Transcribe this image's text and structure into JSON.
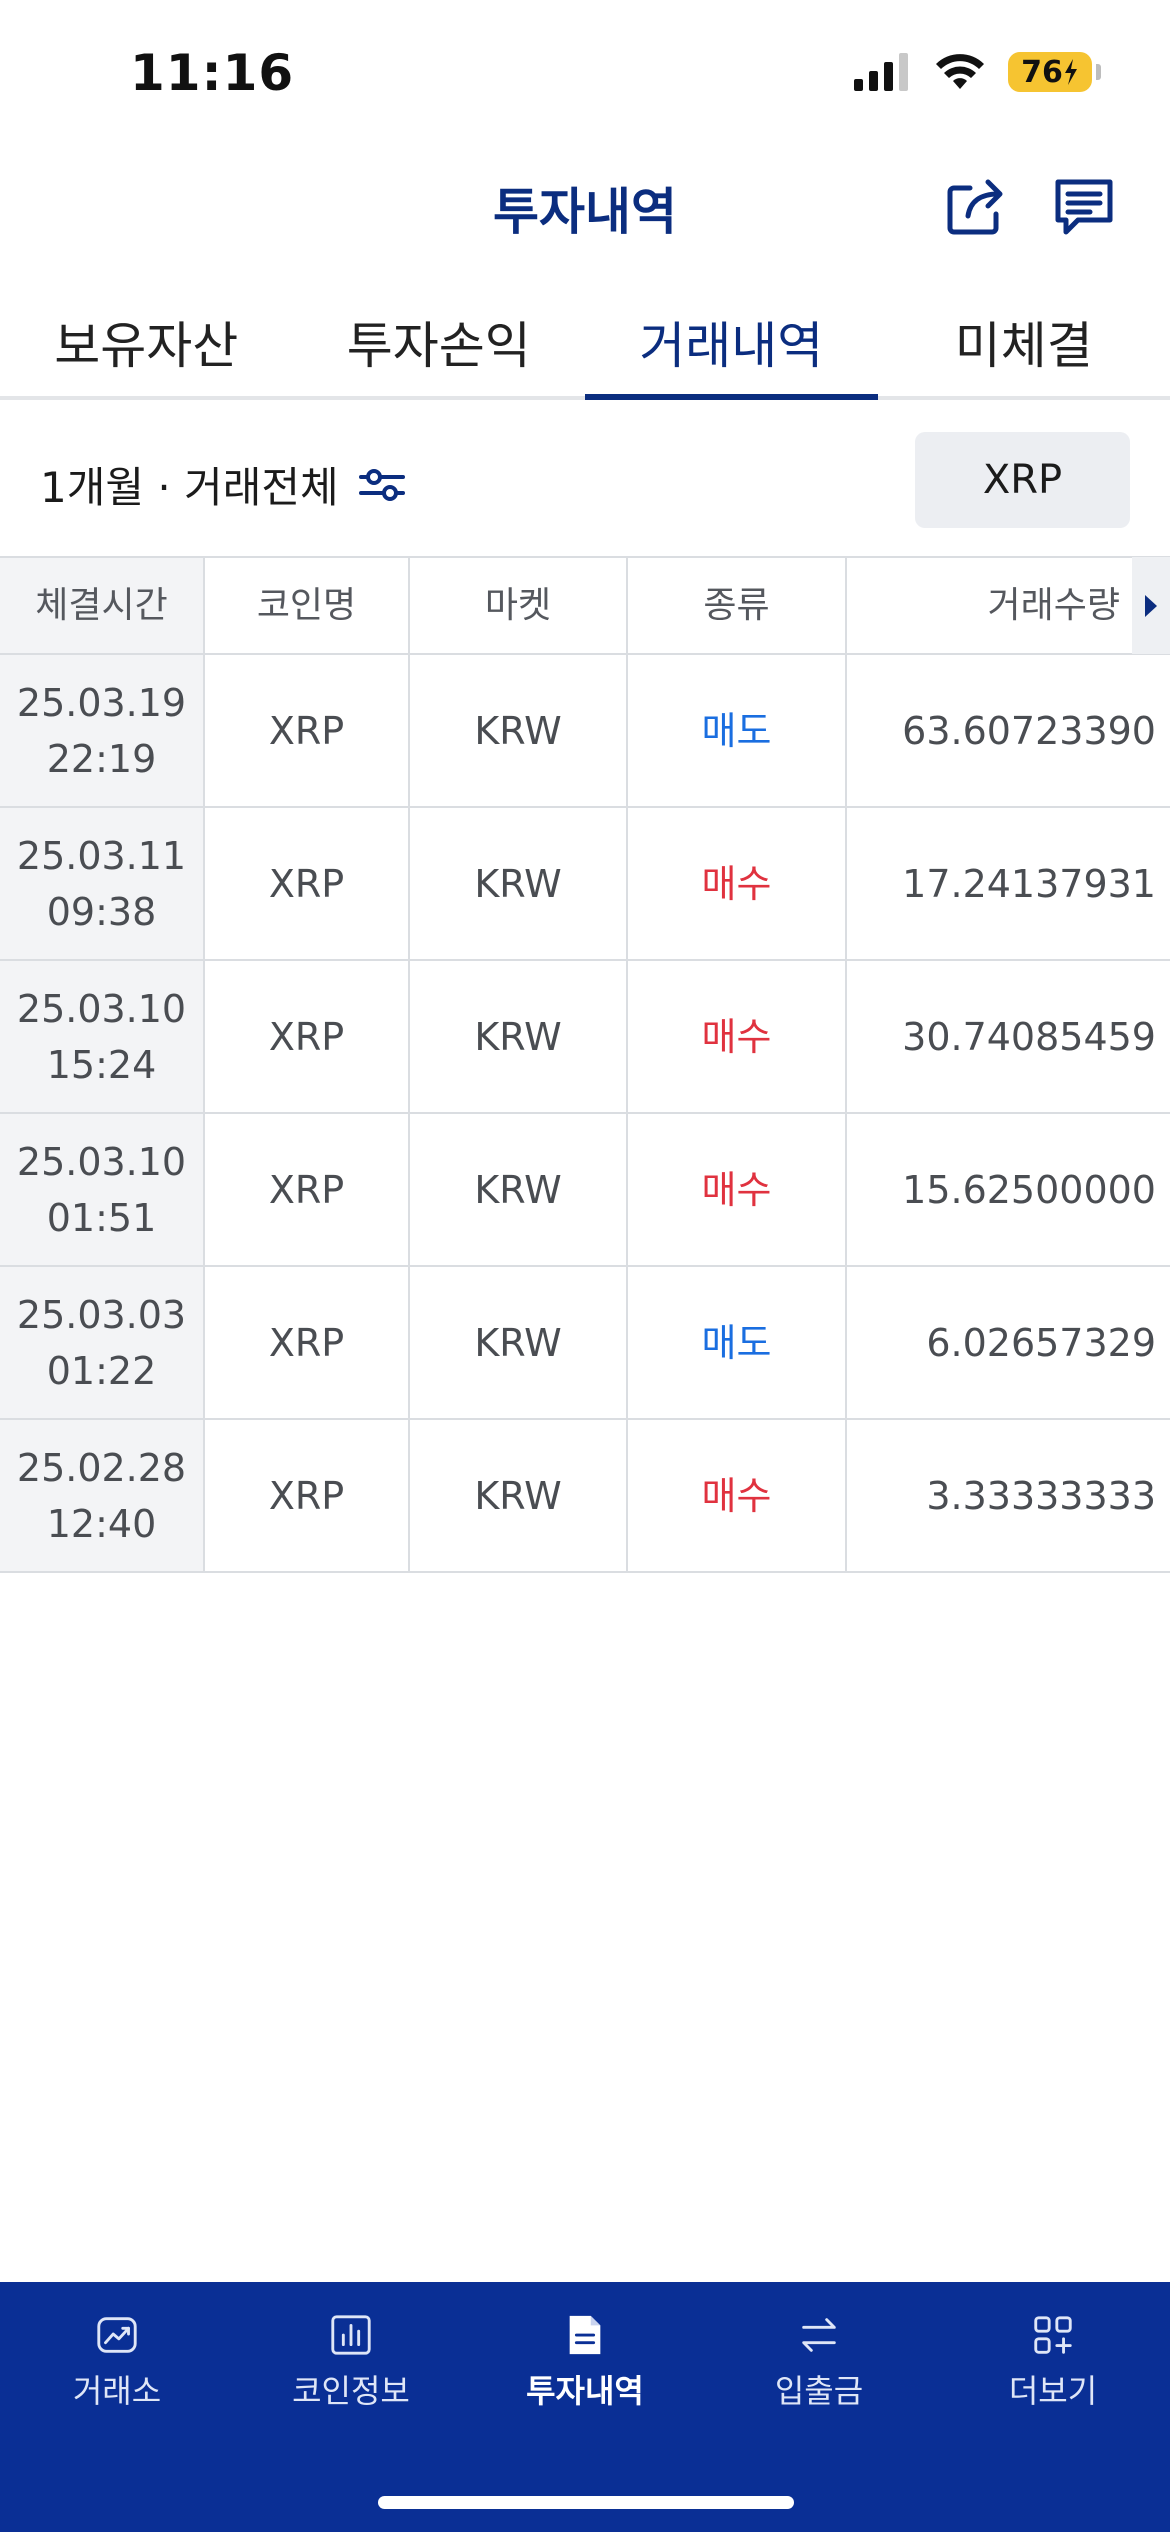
{
  "status": {
    "time": "11:16",
    "battery": "76"
  },
  "header": {
    "title": "투자내역"
  },
  "tabs": [
    {
      "label": "보유자산"
    },
    {
      "label": "투자손익"
    },
    {
      "label": "거래내역"
    },
    {
      "label": "미체결"
    }
  ],
  "filter": {
    "label": "1개월 · 거래전체",
    "coin_button": "XRP"
  },
  "table": {
    "headers": [
      "체결시간",
      "코인명",
      "마켓",
      "종류",
      "거래수량"
    ],
    "rows": [
      {
        "date": "25.03.19",
        "time": "22:19",
        "coin": "XRP",
        "market": "KRW",
        "type": "매도",
        "qty": "63.60723390"
      },
      {
        "date": "25.03.11",
        "time": "09:38",
        "coin": "XRP",
        "market": "KRW",
        "type": "매수",
        "qty": "17.24137931"
      },
      {
        "date": "25.03.10",
        "time": "15:24",
        "coin": "XRP",
        "market": "KRW",
        "type": "매수",
        "qty": "30.74085459"
      },
      {
        "date": "25.03.10",
        "time": "01:51",
        "coin": "XRP",
        "market": "KRW",
        "type": "매수",
        "qty": "15.62500000"
      },
      {
        "date": "25.03.03",
        "time": "01:22",
        "coin": "XRP",
        "market": "KRW",
        "type": "매도",
        "qty": "6.02657329"
      },
      {
        "date": "25.02.28",
        "time": "12:40",
        "coin": "XRP",
        "market": "KRW",
        "type": "매수",
        "qty": "3.33333333"
      }
    ]
  },
  "nav": [
    {
      "label": "거래소",
      "icon": "chart-line-icon"
    },
    {
      "label": "코인정보",
      "icon": "bar-chart-icon"
    },
    {
      "label": "투자내역",
      "icon": "document-icon"
    },
    {
      "label": "입출금",
      "icon": "transfer-icon"
    },
    {
      "label": "더보기",
      "icon": "more-grid-icon"
    }
  ],
  "colors": {
    "brand": "#0b2d7f",
    "nav_bg": "#0a2f95",
    "sell": "#1a6ee0",
    "buy": "#e0323f"
  }
}
